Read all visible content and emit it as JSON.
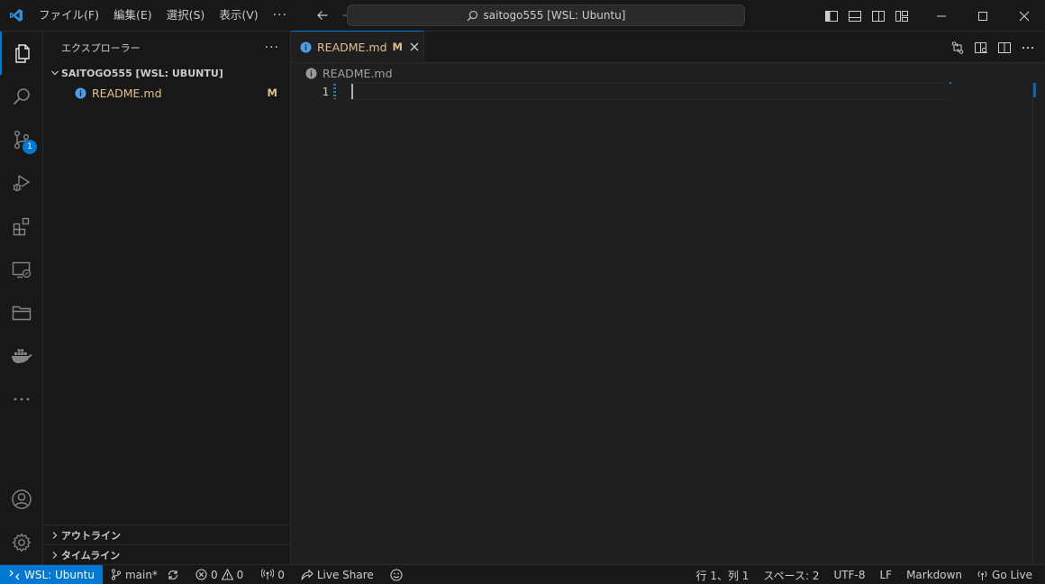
{
  "titlebar": {
    "menus": [
      "ファイル(F)",
      "編集(E)",
      "選択(S)",
      "表示(V)"
    ],
    "more": "···",
    "command_center": "saitogo555 [WSL: Ubuntu]"
  },
  "activitybar": {
    "items": [
      "explorer-icon",
      "search-icon",
      "source-control-icon",
      "run-debug-icon",
      "extensions-icon",
      "remote-explorer-icon",
      "folder-icon",
      "docker-icon",
      "more-icon"
    ],
    "source_control_badge": "1",
    "bottom": [
      "account-icon",
      "settings-gear-icon"
    ]
  },
  "sidebar": {
    "title": "エクスプローラー",
    "more": "···",
    "folder": "SAITOGO555 [WSL: UBUNTU]",
    "files": [
      {
        "name": "README.md",
        "status": "M",
        "icon": "info-icon"
      }
    ],
    "sections": [
      "アウトライン",
      "タイムライン"
    ]
  },
  "editor": {
    "tab": {
      "label": "README.md",
      "modified": "M"
    },
    "breadcrumb": "README.md",
    "line_number": "1"
  },
  "statusbar": {
    "remote": "WSL: Ubuntu",
    "branch": "main*",
    "errors": "0",
    "warnings": "0",
    "ports": "0",
    "live_share": "Live Share",
    "position": "行 1、列 1",
    "indent": "スペース: 2",
    "encoding": "UTF-8",
    "eol": "LF",
    "language": "Markdown",
    "go_live": "Go Live"
  },
  "colors": {
    "accent": "#0078d4",
    "modified_file": "#e2c08d",
    "background": "#1f1f1f",
    "chrome": "#181818"
  }
}
